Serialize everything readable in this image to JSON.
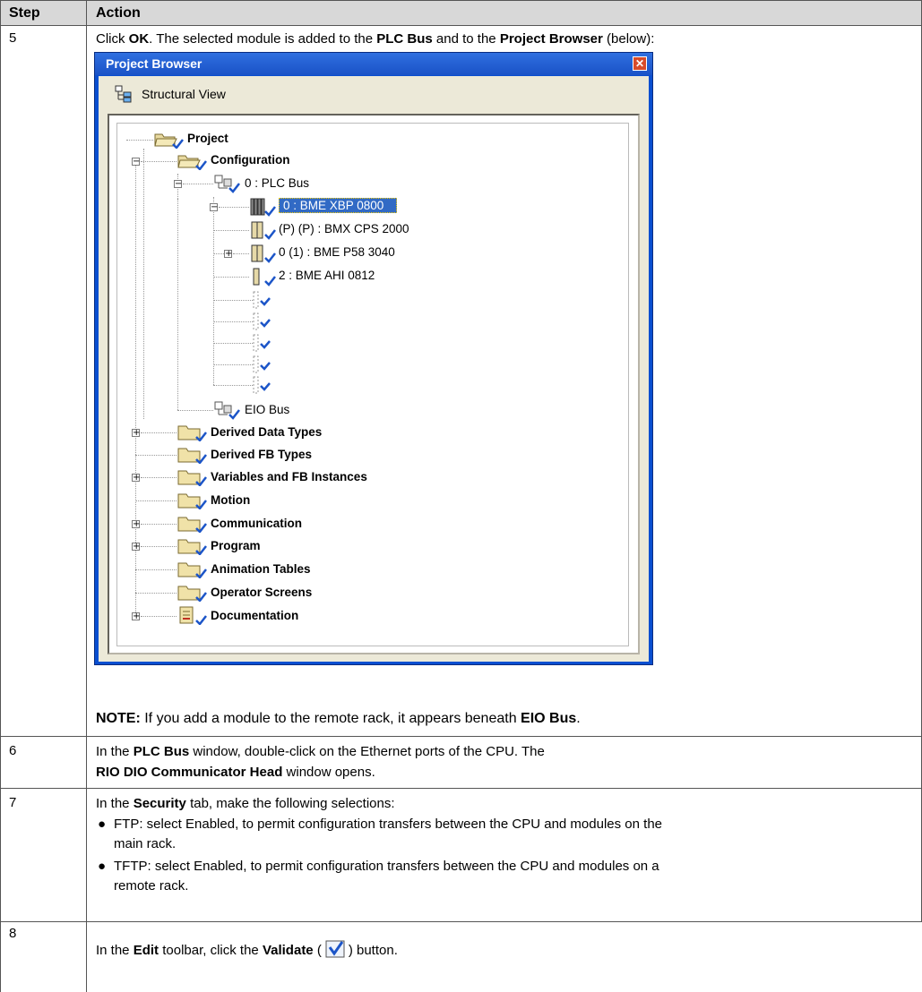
{
  "table": {
    "header_step": "Step",
    "header_action": "Action"
  },
  "step5": {
    "number": "5",
    "text_parts": [
      "Click ",
      "OK",
      ". The selected module is added to the ",
      "PLC Bus",
      " and to the ",
      "Project Browser",
      " (below):"
    ],
    "note_label": "NOTE:",
    "note_text": " If you add a module to the remote rack, it appears beneath ",
    "note_bold": "EIO Bus",
    "note_end": "."
  },
  "browser": {
    "title": "Project Browser",
    "view_label": "Structural View",
    "tree": {
      "project": "Project",
      "configuration": "Configuration",
      "plc_bus": "0 : PLC Bus",
      "rack": "0 : BME XBP 0800",
      "power": "(P) (P) : BMX CPS 2000",
      "cpu": "0 (1) : BME P58 3040",
      "ahi": "2 : BME AHI 0812",
      "eio_bus": "EIO Bus",
      "derived_data": "Derived Data Types",
      "derived_fb": "Derived FB Types",
      "variables": "Variables and FB Instances",
      "motion": "Motion",
      "communication": "Communication",
      "program": "Program",
      "animation": "Animation Tables",
      "operator": "Operator Screens",
      "documentation": "Documentation"
    }
  },
  "step6": {
    "number": "6",
    "l1a": "In the ",
    "l1b": "PLC Bus",
    "l1c": " window, double-click on the Ethernet ports of the CPU. The",
    "l2a": "RIO DIO Communicator Head",
    "l2b": " window opens."
  },
  "step7": {
    "number": "7",
    "l1a": "In the ",
    "l1b": "Security",
    "l1c": " tab, make the following selections:",
    "b1a": "FTP: select Enabled, to permit configuration transfers between the CPU and modules on the",
    "b1b": "main rack.",
    "b2a": "TFTP: select Enabled, to permit configuration transfers between the CPU and modules on a",
    "b2b": "remote rack.",
    "bullet": "●"
  },
  "step8": {
    "number": "8",
    "a": "In the ",
    "b": "Edit",
    "c": " toolbar, click the ",
    "d": "Validate",
    "e": " (",
    "f": ") button."
  }
}
